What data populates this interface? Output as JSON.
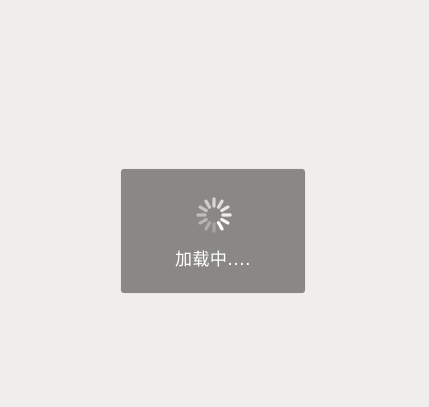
{
  "loading": {
    "text": "加载中....",
    "spinner_icon": "loading-spinner-icon"
  },
  "colors": {
    "page_background": "#efeeec",
    "dialog_background": "#8a8884",
    "text": "#ffffff"
  }
}
